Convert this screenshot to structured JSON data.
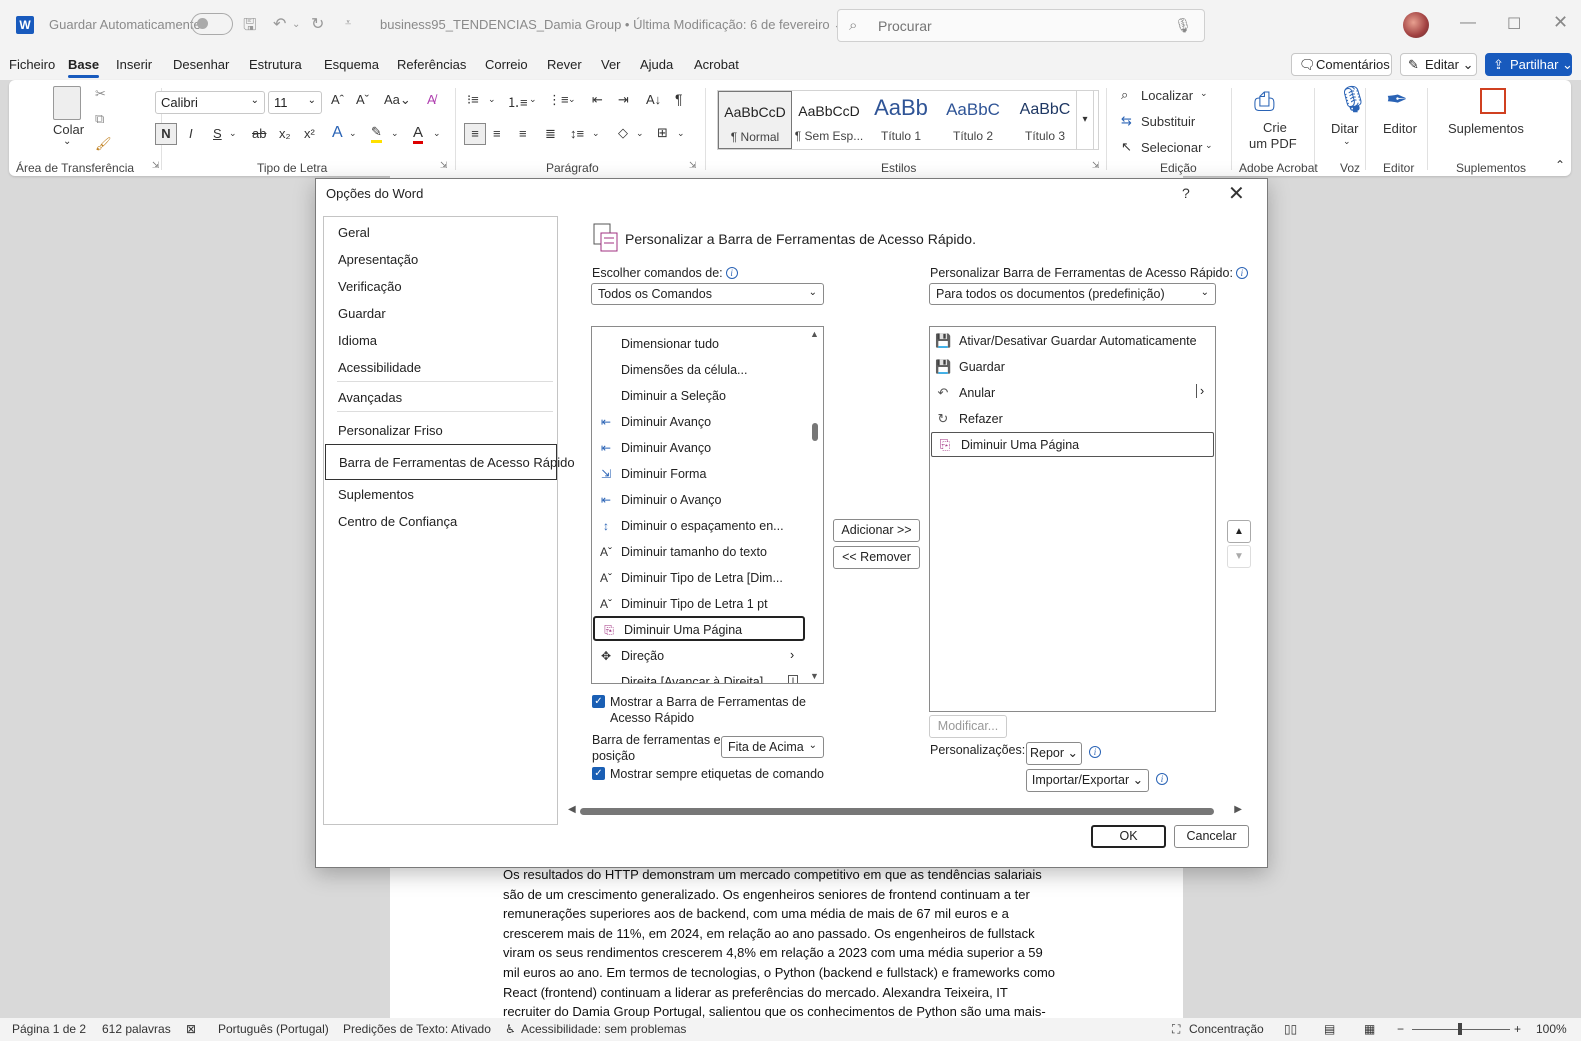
{
  "titlebar": {
    "autosave_label": "Guardar Automaticamente",
    "doc_title": "business95_TENDENCIAS_Damia Group  •  Última Modificação: 6 de fevereiro ⌄",
    "search_placeholder": "Procurar"
  },
  "menu": {
    "items": [
      "Ficheiro",
      "Base",
      "Inserir",
      "Desenhar",
      "Estrutura",
      "Esquema",
      "Referências",
      "Correio",
      "Rever",
      "Ver",
      "Ajuda",
      "Acrobat"
    ],
    "comments": "Comentários",
    "edit": "Editar",
    "share": "Partilhar"
  },
  "ribbon": {
    "paste": "Colar",
    "font_name": "Calibri",
    "font_size": "11",
    "styles": [
      {
        "preview": "AaBbCcD",
        "name": "¶ Normal"
      },
      {
        "preview": "AaBbCcD",
        "name": "¶ Sem Esp..."
      },
      {
        "preview": "AaBb",
        "name": "Título 1"
      },
      {
        "preview": "AaBbC",
        "name": "Título 2"
      },
      {
        "preview": "AaBbC",
        "name": "Título 3"
      }
    ],
    "find": "Localizar",
    "replace": "Substituir",
    "select": "Selecionar",
    "create_pdf_1": "Crie",
    "create_pdf_2": "um PDF",
    "dictate": "Ditar",
    "editor": "Editor",
    "addins": "Suplementos",
    "groups": [
      "Área de Transferência",
      "Tipo de Letra",
      "Parágrafo",
      "Estilos",
      "Edição",
      "Adobe Acrobat",
      "Voz",
      "Editor",
      "Suplementos"
    ]
  },
  "dialog": {
    "title": "Opções do Word",
    "help": "?",
    "nav": [
      "Geral",
      "Apresentação",
      "Verificação",
      "Guardar",
      "Idioma",
      "Acessibilidade",
      "Avançadas",
      "Personalizar Friso",
      "Barra de Ferramentas de Acesso Rápido",
      "Suplementos",
      "Centro de Confiança"
    ],
    "section_title": "Personalizar a Barra de Ferramentas de Acesso Rápido.",
    "choose_label": "Escolher comandos de:",
    "choose_value": "Todos os Comandos",
    "customize_label": "Personalizar Barra de Ferramentas de Acesso Rápido:",
    "customize_value": "Para todos os documentos (predefinição)",
    "commands": [
      {
        "label": "Dimensionar tudo",
        "icon": ""
      },
      {
        "label": "Dimensões da célula...",
        "icon": ""
      },
      {
        "label": "Diminuir a Seleção",
        "icon": ""
      },
      {
        "label": "Diminuir Avanço",
        "icon": "⇤"
      },
      {
        "label": "Diminuir Avanço",
        "icon": "⇤"
      },
      {
        "label": "Diminuir Forma",
        "icon": "⇲"
      },
      {
        "label": "Diminuir o Avanço",
        "icon": "⇤"
      },
      {
        "label": "Diminuir o espaçamento en...",
        "icon": "↕"
      },
      {
        "label": "Diminuir tamanho do texto",
        "icon": "Aˇ"
      },
      {
        "label": "Diminuir Tipo de Letra [Dim...",
        "icon": "Aˇ"
      },
      {
        "label": "Diminuir Tipo de Letra 1 pt",
        "icon": "Aˇ"
      },
      {
        "label": "Diminuir Uma Página",
        "icon": "⎘"
      },
      {
        "label": "Direção",
        "icon": "✥"
      },
      {
        "label": "Direita [Avançar à Direita]",
        "icon": ""
      }
    ],
    "toolbar_items": [
      {
        "label": "Ativar/Desativar Guardar Automaticamente",
        "icon": "💾"
      },
      {
        "label": "Guardar",
        "icon": "💾"
      },
      {
        "label": "Anular",
        "icon": "↶"
      },
      {
        "label": "Refazer",
        "icon": "↻"
      },
      {
        "label": "Diminuir Uma Página",
        "icon": "⎘"
      }
    ],
    "add_btn": "Adicionar >>",
    "remove_btn": "<< Remover",
    "show_toolbar_1": "Mostrar a Barra de Ferramentas de",
    "show_toolbar_2": "Acesso Rápido",
    "position_label_1": "Barra de ferramentas e",
    "position_label_2": "posição",
    "position_value": "Fita de Acima",
    "always_labels": "Mostrar sempre etiquetas de comando",
    "modify_btn": "Modificar...",
    "customizations_label": "Personalizações:",
    "reset_btn": "Repor",
    "import_export_btn": "Importar/Exportar",
    "ok": "OK",
    "cancel": "Cancelar"
  },
  "document": {
    "lines": [
      "Os resultados do HTTP demonstram um mercado competitivo em que as tendências salariais",
      "são de um crescimento generalizado. Os engenheiros seniores de frontend continuam a ter",
      "remunerações superiores aos de backend, com uma média de mais de 67 mil euros e a",
      "crescerem mais de 11%, em 2024, em relação ao ano passado. Os engenheiros de fullstack",
      "viram os seus rendimentos crescerem 4,8% em relação a 2023 com uma média superior a 59",
      "mil euros ao ano. Em termos de tecnologias, o Python (backend e fullstack) e frameworks como",
      "React (frontend) continuam a liderar as preferências do mercado. Alexandra Teixeira, IT",
      "recruiter do Damia Group Portugal, salientou que os conhecimentos de Python são uma mais-"
    ]
  },
  "status": {
    "page": "Página 1 de 2",
    "words": "612 palavras",
    "language": "Português (Portugal)",
    "predictions": "Predições de Texto: Ativado",
    "accessibility": "Acessibilidade: sem problemas",
    "focus": "Concentração",
    "zoom": "100%"
  },
  "colors": {
    "accent": "#185abd",
    "checkbox": "#1a5fb4"
  }
}
